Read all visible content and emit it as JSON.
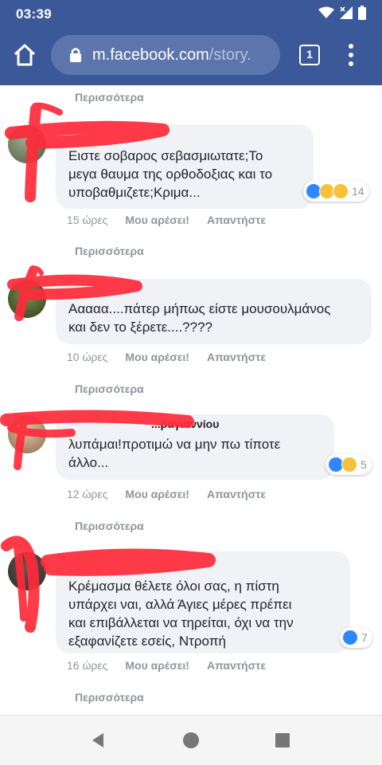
{
  "status_bar": {
    "time": "03:39"
  },
  "browser": {
    "url_host": "m.facebook.com",
    "url_path": "/story.",
    "tab_count": "1"
  },
  "labels": {
    "more": "Περισσότερα",
    "like": "Μου αρέσει!",
    "reply": "Απαντήστε"
  },
  "comments": [
    {
      "name": "",
      "text": "Ειστε σοβαρος σεβασμιωτατε;Το\nμεγα θαυμα της ορθοδοξιας και το\nυποβαθμιζετε;Κριμα...",
      "time": "15 ώρες",
      "reaction_count": "14",
      "reactions": [
        "like-icon",
        "sad-icon",
        "haha-icon"
      ]
    },
    {
      "name": "",
      "text": "Ααααα....πάτερ μήπως είστε μουσουλμάνος\nκαι δεν το ξέρετε....????",
      "time": "10 ώρες",
      "reaction_count": "",
      "reactions": []
    },
    {
      "name": "...ραγιαννίου",
      "text": "λυπάμαι!προτιμώ να μην πω τίποτε\nάλλο...",
      "time": "12 ώρες",
      "reaction_count": "5",
      "reactions": [
        "like-icon",
        "sad-icon"
      ]
    },
    {
      "name": "",
      "text": "Κρέμασμα θέλετε όλοι σας, η πίστη\nυπάρχει ναι, αλλά Άγιες μέρες πρέπει\nκαι επιβάλλεται να τηρείται, όχι να την\nεξαφανίζετε εσείς, Ντροπή",
      "time": "16 ώρες",
      "reaction_count": "7",
      "reactions": [
        "like-icon"
      ]
    }
  ],
  "colors": {
    "facebook_blue": "#3b5998",
    "redaction": "#ff2a3a",
    "like": "#2d88ff",
    "emoji_yellow": "#f7c23a"
  }
}
